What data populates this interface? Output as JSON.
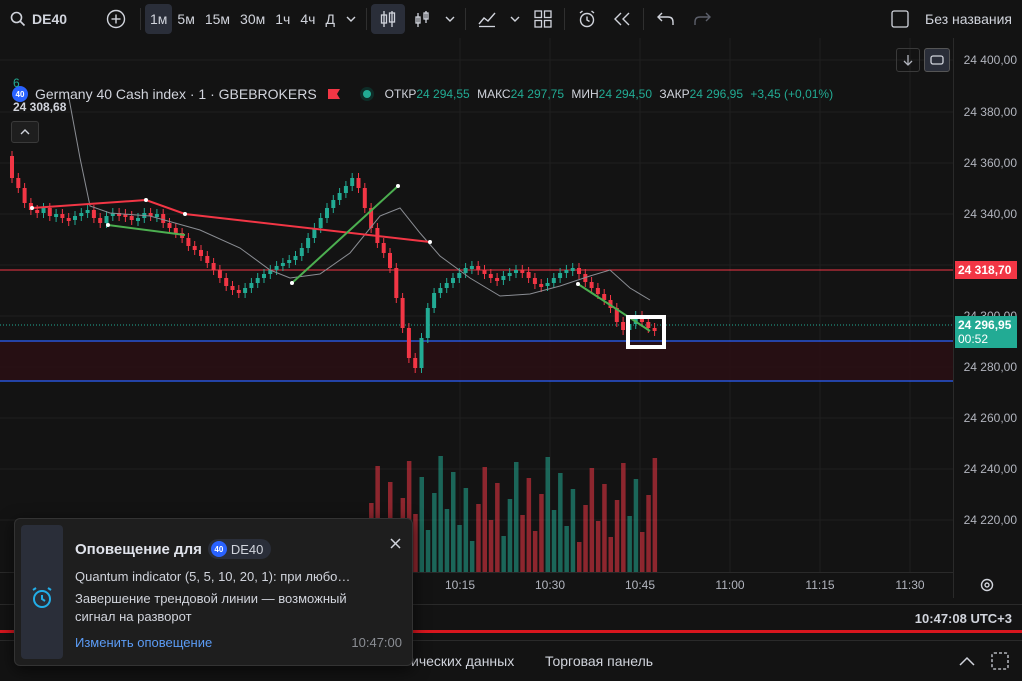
{
  "toolbar": {
    "symbol": "DE40",
    "intervals": [
      "1м",
      "5м",
      "15м",
      "30м",
      "1ч",
      "4ч",
      "Д"
    ],
    "active_interval": "1м",
    "layout_name": "Без названия"
  },
  "legend": {
    "title": "Germany 40 Cash index · 1 · GBEBROKERS",
    "badge": "40",
    "open_label": "ОТКР",
    "open": "24 294,55",
    "high_label": "МАКС",
    "high": "24 297,75",
    "low_label": "МИН",
    "low": "24 294,50",
    "close_label": "ЗАКР",
    "close": "24 296,95",
    "change": "+3,45 (+0,01%)",
    "indicator_value": "6",
    "prev_high": "24 308,68"
  },
  "price_axis": {
    "labels": [
      "24 400,00",
      "24 380,00",
      "24 360,00",
      "24 340,00",
      "24 300,00",
      "24 280,00",
      "24 260,00",
      "24 240,00",
      "24 220,00"
    ],
    "red_tag": "24 318,70",
    "current_price": "24 296,95",
    "countdown": "00:52"
  },
  "time_axis": {
    "labels": [
      "10:15",
      "10:30",
      "10:45",
      "11:00",
      "11:15",
      "11:30"
    ],
    "clock": "10:47:08 UTC+3"
  },
  "bottom_tabs": {
    "tab_partial": "ических данных",
    "trading_panel": "Торговая панель"
  },
  "alert": {
    "title": "Оповещение для",
    "badge": "40",
    "symbol": "DE40",
    "line1": "Quantum indicator (5, 5, 10, 20, 1): при любо…",
    "line2": "Завершение трендовой линии — возможный",
    "line3": "сигнал на разворот",
    "edit_link": "Изменить оповещение",
    "time": "10:47:00"
  },
  "colors": {
    "up": "#22ab94",
    "down": "#f23645",
    "accent": "#2962ff",
    "trend_red": "#f23645",
    "trend_green": "#4caf50"
  }
}
